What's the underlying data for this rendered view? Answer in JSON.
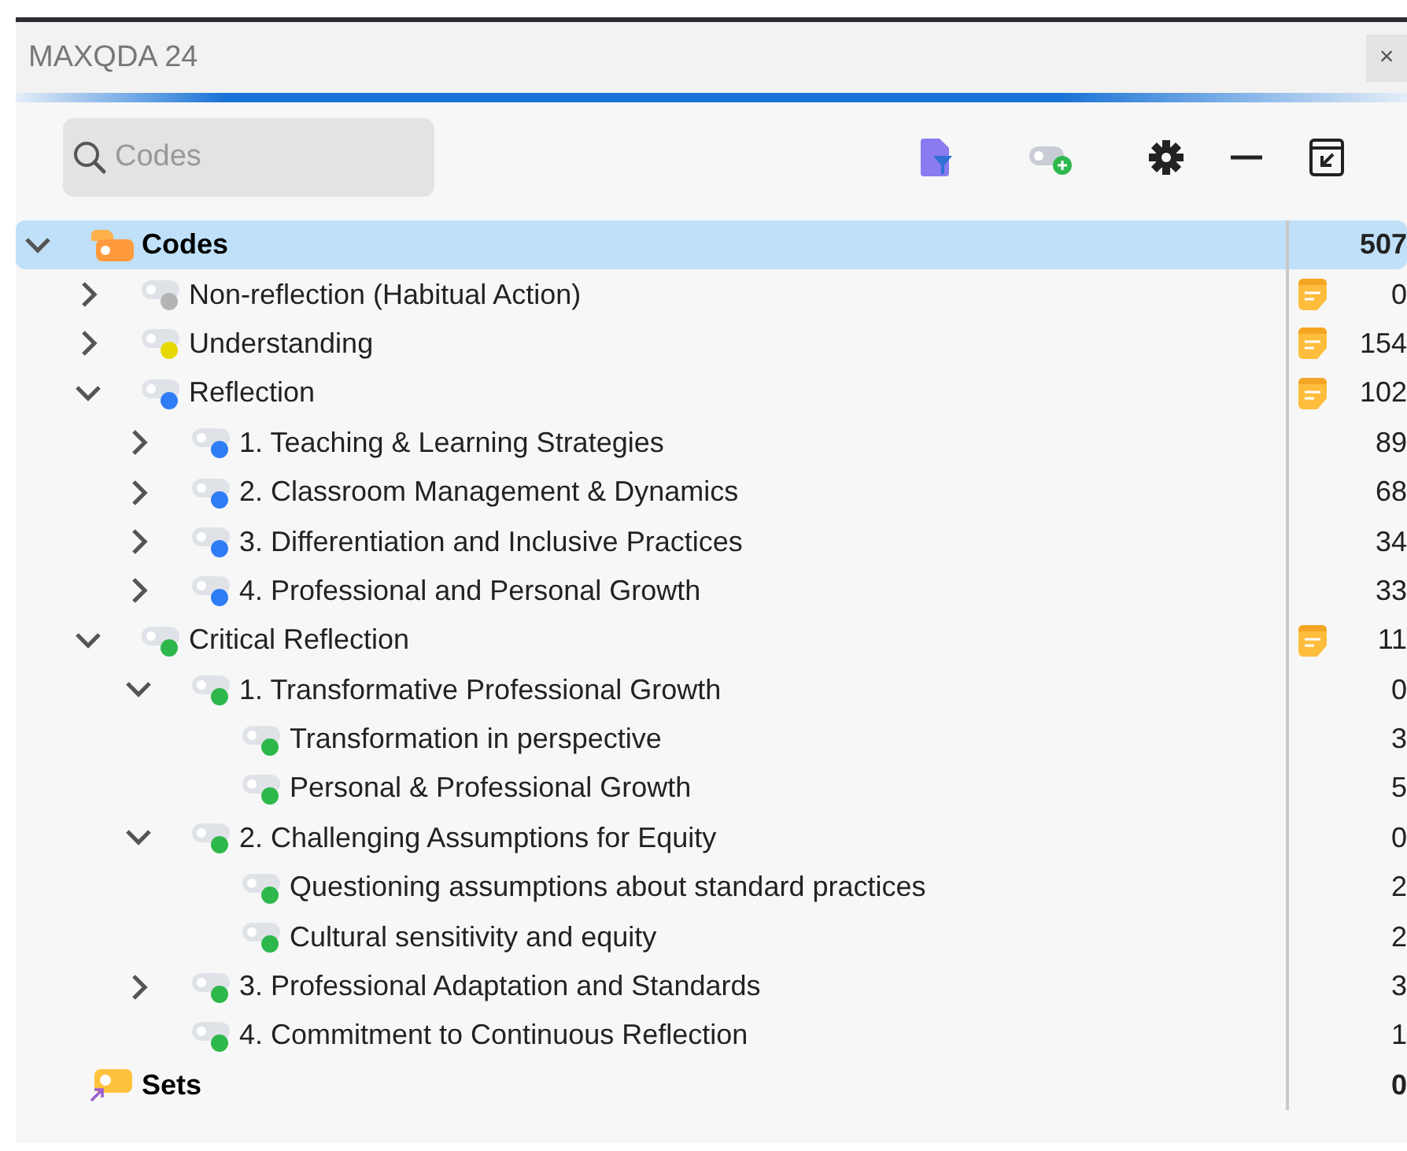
{
  "window": {
    "title": "MAXQDA 24",
    "close": "×"
  },
  "search": {
    "placeholder": "Codes"
  },
  "tree": [
    {
      "kind": "root",
      "label": "Codes",
      "count": "507",
      "selected": true,
      "expanded": true,
      "children": [
        {
          "label": "Non-reflection (Habitual Action)",
          "color": "#b4b4b4",
          "memo": true,
          "count": "0",
          "expanded": false
        },
        {
          "label": "Understanding",
          "color": "#e6d800",
          "memo": true,
          "count": "154",
          "expanded": false
        },
        {
          "label": "Reflection",
          "color": "#2f7df6",
          "memo": true,
          "count": "102",
          "expanded": true,
          "children": [
            {
              "label": "1. Teaching & Learning Strategies",
              "color": "#2f7df6",
              "count": "89",
              "expanded": false
            },
            {
              "label": "2. Classroom Management & Dynamics",
              "color": "#2f7df6",
              "count": "68",
              "expanded": false
            },
            {
              "label": "3. Differentiation and Inclusive Practices",
              "color": "#2f7df6",
              "count": "34",
              "expanded": false
            },
            {
              "label": "4. Professional and Personal Growth",
              "color": "#2f7df6",
              "count": "33",
              "expanded": false
            }
          ]
        },
        {
          "label": "Critical Reflection",
          "color": "#2eb84c",
          "memo": true,
          "count": "11",
          "expanded": true,
          "children": [
            {
              "label": "1. Transformative Professional Growth",
              "color": "#2eb84c",
              "count": "0",
              "expanded": true,
              "children": [
                {
                  "label": "Transformation in perspective",
                  "color": "#2eb84c",
                  "count": "3"
                },
                {
                  "label": "Personal & Professional Growth",
                  "color": "#2eb84c",
                  "count": "5"
                }
              ]
            },
            {
              "label": "2. Challenging Assumptions for Equity",
              "color": "#2eb84c",
              "count": "0",
              "expanded": true,
              "children": [
                {
                  "label": "Questioning assumptions about standard practices",
                  "color": "#2eb84c",
                  "count": "2"
                },
                {
                  "label": "Cultural sensitivity and equity",
                  "color": "#2eb84c",
                  "count": "2"
                }
              ]
            },
            {
              "label": "3. Professional Adaptation and Standards",
              "color": "#2eb84c",
              "count": "3",
              "expanded": false
            },
            {
              "label": "4. Commitment to Continuous Reflection",
              "color": "#2eb84c",
              "count": "1"
            }
          ]
        }
      ]
    },
    {
      "kind": "sets",
      "label": "Sets",
      "count": "0"
    }
  ]
}
